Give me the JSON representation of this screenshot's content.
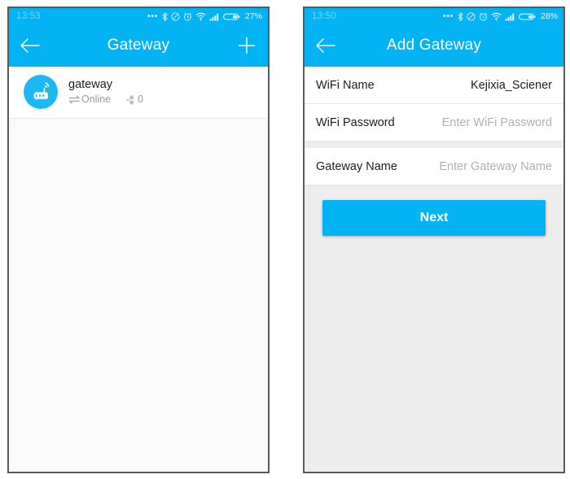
{
  "colors": {
    "accent": "#03b3f3",
    "icon_circle": "#1cb8f2",
    "page_bg": "#ededed",
    "card_bg": "#ffffff",
    "text_primary": "#1d1d1d",
    "text_muted": "#9a9a9a",
    "placeholder": "#b0b0b0",
    "frame_border": "#5a5a5a"
  },
  "left_phone": {
    "status_bar": {
      "time": "13:53",
      "dots": "•••",
      "icons": [
        "bluetooth-icon",
        "do-not-disturb-icon",
        "alarm-icon",
        "wifi-icon",
        "cellular-signal-icon",
        "battery-icon"
      ],
      "battery_percent": "27%"
    },
    "app_bar": {
      "back_icon": "back-arrow-icon",
      "title": "Gateway",
      "add_icon": "plus-icon"
    },
    "list": {
      "items": [
        {
          "icon": "gateway-router-icon",
          "name": "gateway",
          "status_icon": "connection-arrows-icon",
          "status": "Online",
          "lock_icon": "lock-device-icon",
          "lock_count": "0"
        }
      ]
    }
  },
  "right_phone": {
    "status_bar": {
      "time": "13:50",
      "dots": "•••",
      "icons": [
        "bluetooth-icon",
        "do-not-disturb-icon",
        "alarm-icon",
        "wifi-icon",
        "cellular-signal-icon",
        "battery-icon"
      ],
      "battery_percent": "28%"
    },
    "app_bar": {
      "back_icon": "back-arrow-icon",
      "title": "Add Gateway"
    },
    "form": {
      "rows": [
        {
          "label": "WiFi Name",
          "value": "Kejixia_Sciener",
          "placeholder": "",
          "is_placeholder": false
        },
        {
          "label": "WiFi Password",
          "value": "",
          "placeholder": "Enter WiFi Password",
          "is_placeholder": true
        },
        {
          "label": "Gateway Name",
          "value": "",
          "placeholder": "Enter Gateway Name",
          "is_placeholder": true
        }
      ],
      "submit_label": "Next"
    }
  }
}
